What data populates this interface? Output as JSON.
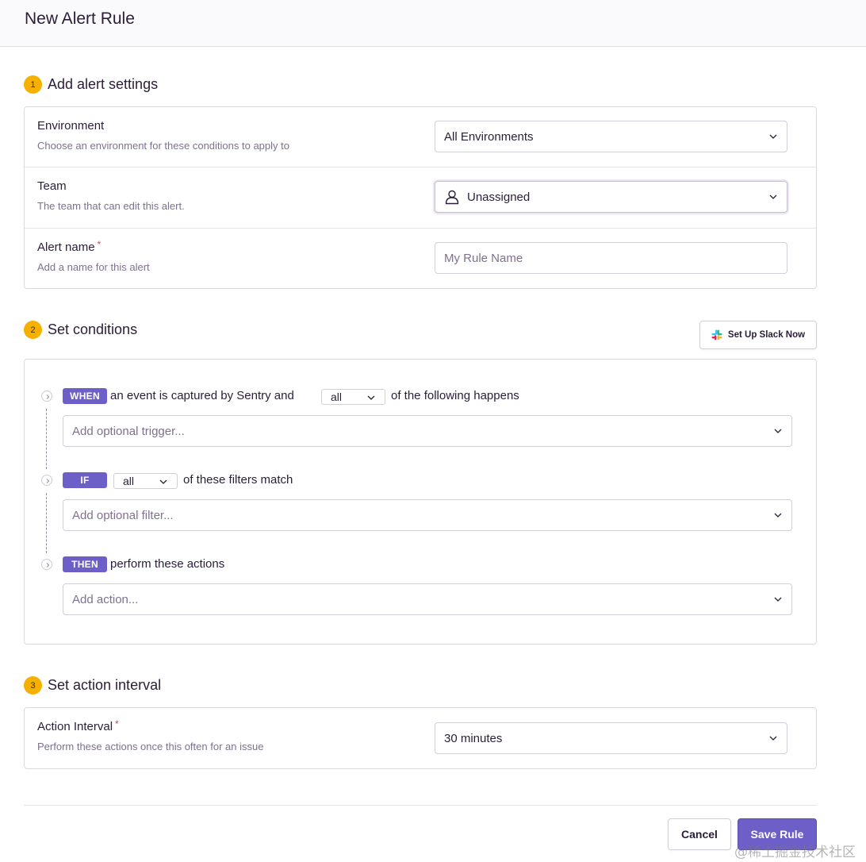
{
  "header": {
    "title": "New Alert Rule"
  },
  "steps": [
    {
      "number": "1",
      "title": "Add alert settings"
    },
    {
      "number": "2",
      "title": "Set conditions"
    },
    {
      "number": "3",
      "title": "Set action interval"
    }
  ],
  "settings": {
    "environment": {
      "label": "Environment",
      "help": "Choose an environment for these conditions to apply to",
      "value": "All Environments"
    },
    "team": {
      "label": "Team",
      "help": "The team that can edit this alert.",
      "value": "Unassigned"
    },
    "alert_name": {
      "label": "Alert name",
      "required_mark": "*",
      "help": "Add a name for this alert",
      "placeholder": "My Rule Name"
    }
  },
  "slack_button": {
    "label": "Set Up Slack Now"
  },
  "conditions": {
    "when": {
      "tag": "WHEN",
      "text_before": "an event is captured by Sentry and",
      "match_value": "all",
      "text_after": "of the following happens",
      "dropdown_placeholder": "Add optional trigger..."
    },
    "if": {
      "tag": "IF",
      "match_value": "all",
      "text_after": "of these filters match",
      "dropdown_placeholder": "Add optional filter..."
    },
    "then": {
      "tag": "THEN",
      "text_after": "perform these actions",
      "dropdown_placeholder": "Add action..."
    }
  },
  "interval": {
    "label": "Action Interval",
    "required_mark": "*",
    "help": "Perform these actions once this often for an issue",
    "value": "30 minutes"
  },
  "footer": {
    "cancel_label": "Cancel",
    "save_label": "Save Rule"
  },
  "watermark": "@稀土掘金技术社区",
  "colors": {
    "accent": "#6c5fc7",
    "step_badge": "#f5b000",
    "required": "#e03e55"
  }
}
